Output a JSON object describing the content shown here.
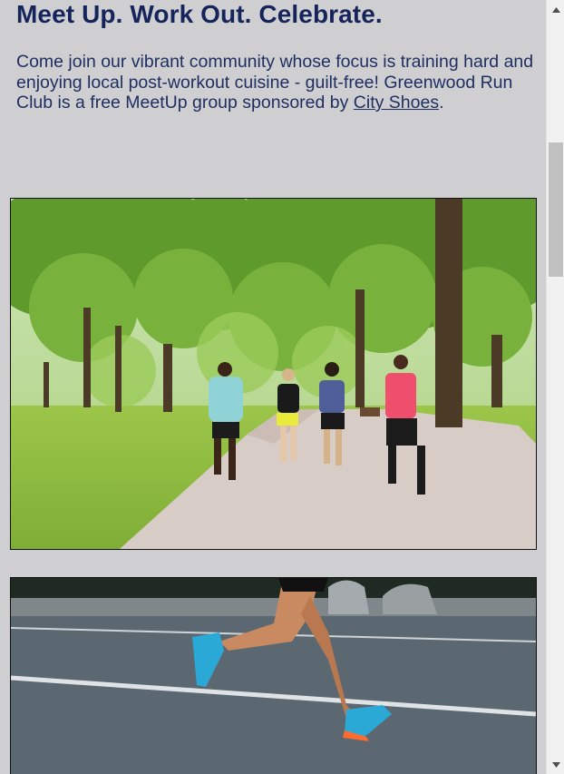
{
  "heading": "Meet Up. Work Out. Celebrate.",
  "intro": {
    "text": "Come join our vibrant community whose focus is training hard and enjoying local post-workout cuisine - guilt-free! Greenwood Run Club is a free MeetUp group sponsored by ",
    "link_text": "City Shoes",
    "suffix": "."
  },
  "images": {
    "first": "runners-in-park-photo",
    "second": "runner-legs-on-road-photo"
  },
  "scrollbar": {
    "up_icon": "caret-up-icon",
    "down_icon": "caret-down-icon"
  }
}
